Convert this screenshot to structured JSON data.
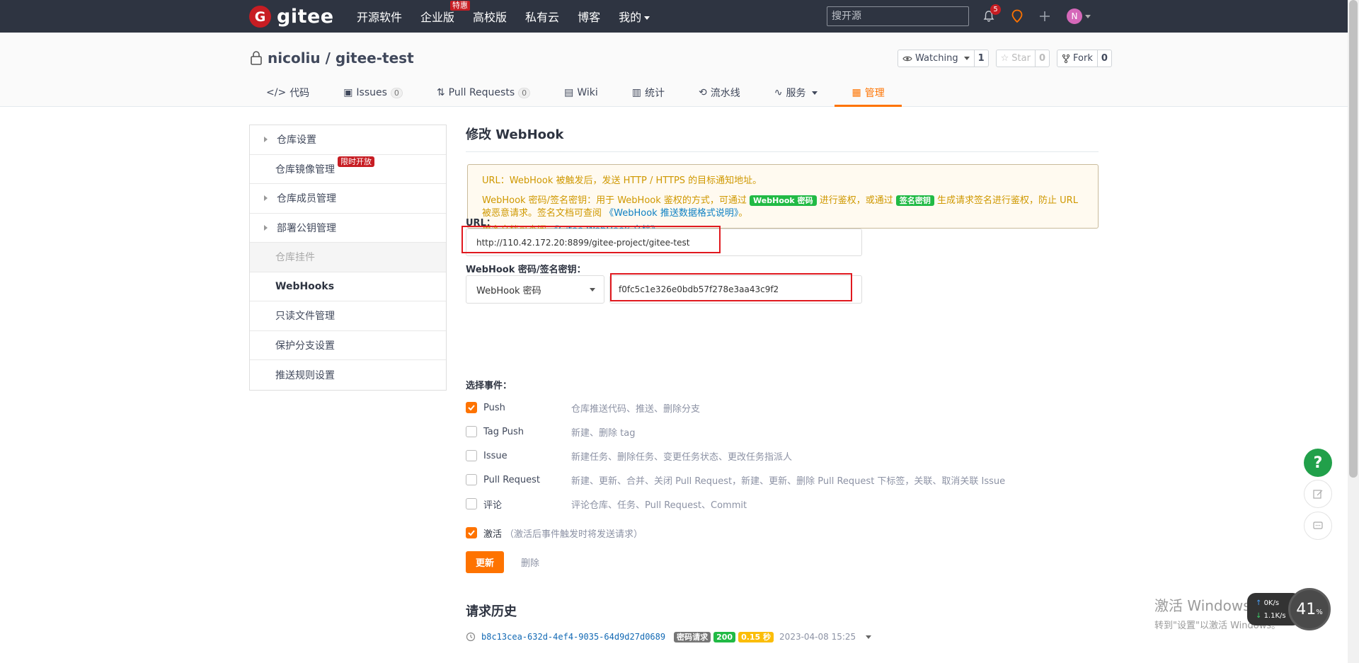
{
  "topnav": {
    "logo_letter": "G",
    "logo_text": "gitee",
    "links": [
      "开源软件",
      "企业版",
      "高校版",
      "私有云",
      "博客",
      "我的"
    ],
    "enterprise_badge": "特惠",
    "search_placeholder": "搜开源",
    "notifications_count": "5",
    "avatar_letter": "N",
    "accent": "#c71d23"
  },
  "repo": {
    "owner": "nicoliu",
    "separator": " / ",
    "name": "gitee-test",
    "watch_label": "Watching",
    "watch_count": "1",
    "star_label": "Star",
    "star_count": "0",
    "fork_label": "Fork",
    "fork_count": "0",
    "tabs": [
      {
        "label": "代码",
        "icon": "code-icon"
      },
      {
        "label": "Issues",
        "count": "0",
        "icon": "issues-icon"
      },
      {
        "label": "Pull Requests",
        "count": "0",
        "icon": "pull-request-icon"
      },
      {
        "label": "Wiki",
        "icon": "wiki-icon"
      },
      {
        "label": "统计",
        "icon": "stats-icon"
      },
      {
        "label": "流水线",
        "icon": "pipeline-icon"
      },
      {
        "label": "服务",
        "icon": "service-icon"
      },
      {
        "label": "管理",
        "icon": "manage-icon"
      }
    ],
    "accent": "#fe7300"
  },
  "sidebar": {
    "items": [
      {
        "label": "仓库设置"
      },
      {
        "label": "仓库镜像管理",
        "badge": "限时开放"
      },
      {
        "label": "仓库成员管理"
      },
      {
        "label": "部署公钥管理"
      },
      {
        "label": "仓库挂件"
      },
      {
        "label": "WebHooks"
      },
      {
        "label": "只读文件管理"
      },
      {
        "label": "保护分支设置"
      },
      {
        "label": "推送规则设置"
      }
    ]
  },
  "main": {
    "title": "修改 WebHook",
    "notice": {
      "line1": "URL：WebHook 被触发后，发送 HTTP / HTTPS 的目标通知地址。",
      "line2_a": "WebHook 密码/签名密钥：用于 WebHook 鉴权的方式，可通过",
      "tag_password": "WebHook 密码",
      "line2_b": "进行鉴权，或通过",
      "tag_sign": "签名密钥",
      "line2_c": "生成请求签名进行鉴权，防止 URL 被恶意请求。签名文档可查阅",
      "link_doc": "《WebHook 推送数据格式说明》",
      "line2_d": "。",
      "line3_a": "更多文档可查阅",
      "link_more": "《Gitee WebHook 文档》",
      "line3_b": "。"
    },
    "url_label": "URL：",
    "url_value": "http://110.42.172.20:8899/gitee-project/gitee-test",
    "secret_label": "WebHook 密码/签名密钥：",
    "secret_type": "WebHook 密码",
    "secret_value": "f0fc5c1e326e0bdb57f278e3aa43c9f2",
    "events_label": "选择事件：",
    "events": [
      {
        "name": "Push",
        "desc": "仓库推送代码、推送、删除分支",
        "checked": true
      },
      {
        "name": "Tag Push",
        "desc": "新建、删除 tag",
        "checked": false
      },
      {
        "name": "Issue",
        "desc": "新建任务、删除任务、变更任务状态、更改任务指派人",
        "checked": false
      },
      {
        "name": "Pull Request",
        "desc": "新建、更新、合并、关闭 Pull Request，新建、更新、删除 Pull Request 下标签，关联、取消关联 Issue",
        "checked": false
      },
      {
        "name": "评论",
        "desc": "评论仓库、任务、Pull Request、Commit",
        "checked": false
      }
    ],
    "activate_label": "激活",
    "activate_note": "（激活后事件触发时将发送请求）",
    "update_button": "更新",
    "delete_button": "删除",
    "history_title": "请求历史",
    "history": {
      "hash": "b8c13cea-632d-4ef4-9035-64d9d27d0689",
      "tag_type": "密码请求",
      "status": "200",
      "duration": "0.15 秒",
      "time": "2023-04-08 15:25"
    }
  },
  "floating": {
    "help": "?",
    "windows_activate_1": "激活 Windows",
    "windows_activate_2": "转到\"设置\"以激活 Windows。",
    "net_up": "0K/s",
    "net_down": "1.1K/s",
    "cpu": "41",
    "cpu_unit": "%"
  }
}
